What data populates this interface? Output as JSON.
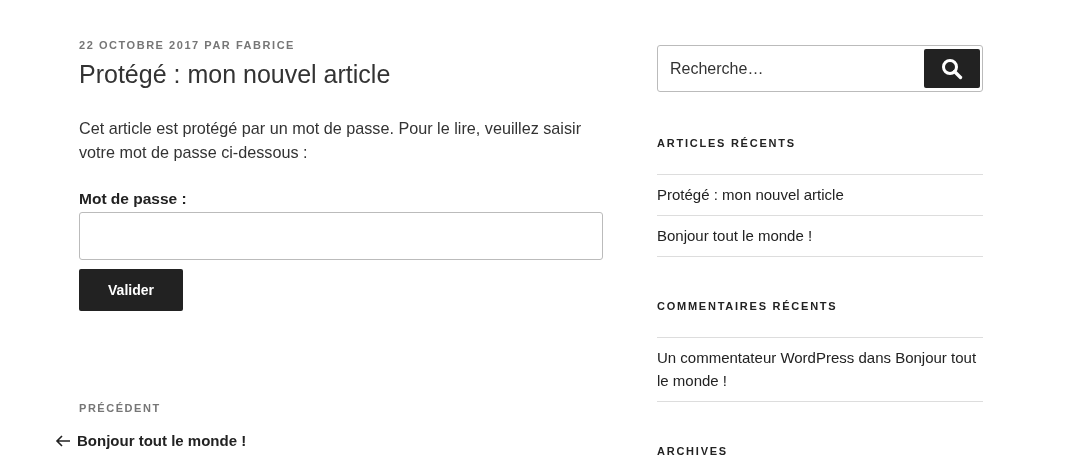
{
  "post": {
    "meta": "22 OCTOBRE 2017 PAR FABRICE",
    "title": "Protégé : mon nouvel article",
    "notice": "Cet article est protégé par un mot de passe. Pour le lire, veuillez saisir votre mot de passe ci-dessous :",
    "password_label": "Mot de passe :",
    "submit": "Valider"
  },
  "post_navigation": {
    "label": "PRÉCÉDENT",
    "link": "Bonjour tout le monde !"
  },
  "sidebar": {
    "search": {
      "placeholder": "Recherche…"
    },
    "widgets": [
      {
        "title": "ARTICLES RÉCENTS",
        "items": [
          "Protégé : mon nouvel article",
          "Bonjour tout le monde !"
        ]
      },
      {
        "title": "COMMENTAIRES RÉCENTS",
        "items": [
          "Un commentateur WordPress dans Bonjour tout le monde !"
        ]
      },
      {
        "title": "ARCHIVES"
      }
    ]
  }
}
